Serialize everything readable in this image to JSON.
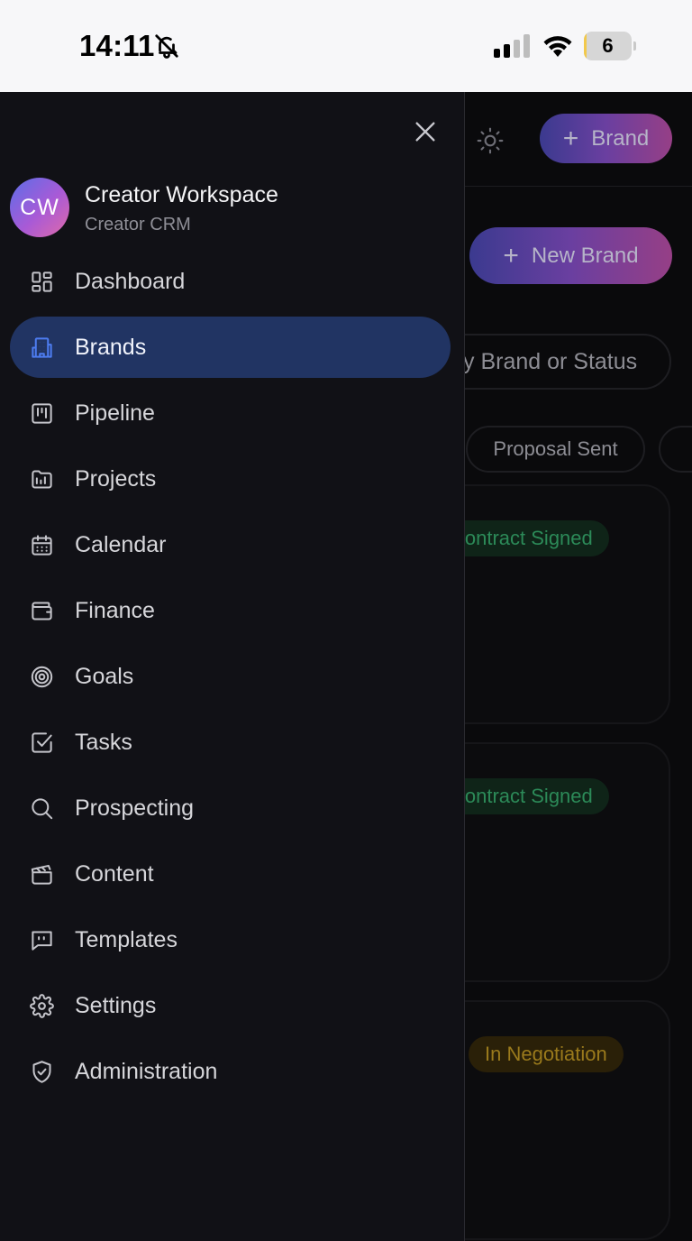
{
  "status_bar": {
    "time": "14:11",
    "battery_level": "6",
    "battery_fraction": 0.06,
    "battery_color": "#f2c94c"
  },
  "background_page": {
    "header_button_label": "Brand",
    "new_brand_label": "New Brand",
    "search_placeholder_visible": "y Brand or Status",
    "filter_chip": "Proposal Sent",
    "cards": [
      {
        "status": "Contract Signed",
        "status_color": "#2c8a58"
      },
      {
        "status": "Contract Signed",
        "status_color": "#2c8a58"
      },
      {
        "status": "In Negotiation",
        "status_color": "#9a7a1c"
      }
    ]
  },
  "drawer": {
    "avatar_initials": "CW",
    "workspace_title": "Creator Workspace",
    "workspace_subtitle": "Creator CRM",
    "accent_color": "#213463",
    "active_item": "Brands",
    "items": [
      {
        "label": "Dashboard",
        "icon": "dashboard-icon"
      },
      {
        "label": "Brands",
        "icon": "building-icon"
      },
      {
        "label": "Pipeline",
        "icon": "kanban-icon"
      },
      {
        "label": "Projects",
        "icon": "folder-icon"
      },
      {
        "label": "Calendar",
        "icon": "calendar-icon"
      },
      {
        "label": "Finance",
        "icon": "wallet-icon"
      },
      {
        "label": "Goals",
        "icon": "target-icon"
      },
      {
        "label": "Tasks",
        "icon": "checkbox-icon"
      },
      {
        "label": "Prospecting",
        "icon": "search-icon"
      },
      {
        "label": "Content",
        "icon": "clapperboard-icon"
      },
      {
        "label": "Templates",
        "icon": "message-square-icon"
      },
      {
        "label": "Settings",
        "icon": "gear-icon"
      },
      {
        "label": "Administration",
        "icon": "shield-check-icon"
      }
    ]
  }
}
